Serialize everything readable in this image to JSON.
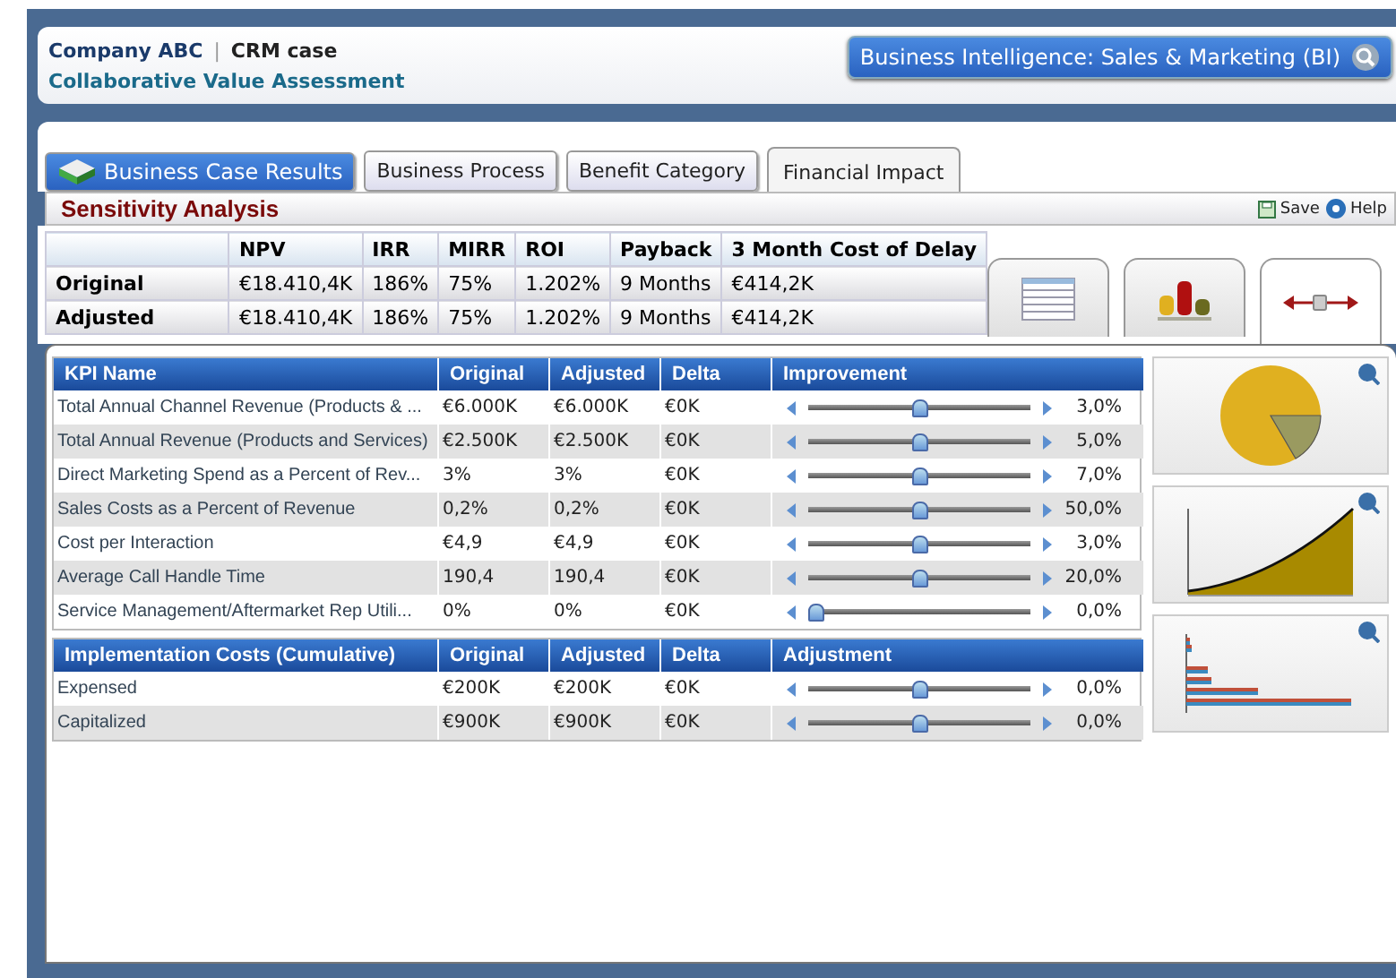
{
  "header": {
    "company": "Company ABC",
    "separator": "|",
    "case": "CRM case",
    "subtitle": "Collaborative Value Assessment",
    "bi_button": "Business Intelligence: Sales & Marketing (BI)"
  },
  "tabs": [
    {
      "label": "Business Case Results",
      "kind": "primary",
      "selected": false
    },
    {
      "label": "Business Process",
      "kind": "tab",
      "selected": false
    },
    {
      "label": "Benefit Category",
      "kind": "tab",
      "selected": false
    },
    {
      "label": "Financial Impact",
      "kind": "tab",
      "selected": true
    }
  ],
  "section": {
    "title": "Sensitivity Analysis",
    "actions": [
      "Save",
      "Help"
    ]
  },
  "summary": {
    "columns": [
      "NPV",
      "IRR",
      "MIRR",
      "ROI",
      "Payback",
      "3 Month Cost of Delay"
    ],
    "rows": [
      {
        "label": "Original",
        "cells": [
          "€18.410,4K",
          "186%",
          "75%",
          "1.202%",
          "9 Months",
          "€414,2K"
        ]
      },
      {
        "label": "Adjusted",
        "cells": [
          "€18.410,4K",
          "186%",
          "75%",
          "1.202%",
          "9 Months",
          "€414,2K"
        ]
      }
    ]
  },
  "view_tabs": [
    {
      "kind": "table",
      "selected": false
    },
    {
      "kind": "bars",
      "selected": false
    },
    {
      "kind": "slider",
      "selected": true
    }
  ],
  "kpi_table": {
    "columns": [
      "KPI Name",
      "Original",
      "Adjusted",
      "Delta",
      "Improvement"
    ],
    "rows": [
      {
        "name": "Total Annual Channel Revenue (Products & ...",
        "original": "€6.000K",
        "adjusted": "€6.000K",
        "delta": "€0K",
        "level": 0.5,
        "reading": "3,0%"
      },
      {
        "name": "Total Annual Revenue (Products and Services)",
        "original": "€2.500K",
        "adjusted": "€2.500K",
        "delta": "€0K",
        "level": 0.5,
        "reading": "5,0%"
      },
      {
        "name": "Direct Marketing Spend as a Percent of Rev...",
        "original": "3%",
        "adjusted": "3%",
        "delta": "€0K",
        "level": 0.5,
        "reading": "7,0%"
      },
      {
        "name": "Sales Costs as a Percent of Revenue",
        "original": "0,2%",
        "adjusted": "0,2%",
        "delta": "€0K",
        "level": 0.5,
        "reading": "50,0%"
      },
      {
        "name": "Cost per Interaction",
        "original": "€4,9",
        "adjusted": "€4,9",
        "delta": "€0K",
        "level": 0.5,
        "reading": "3,0%"
      },
      {
        "name": "Average Call Handle Time",
        "original": "190,4",
        "adjusted": "190,4",
        "delta": "€0K",
        "level": 0.5,
        "reading": "20,0%"
      },
      {
        "name": "Service Management/Aftermarket Rep Utili...",
        "original": "0%",
        "adjusted": "0%",
        "delta": "€0K",
        "level": 0,
        "reading": "0,0%"
      }
    ]
  },
  "cost_table": {
    "columns": [
      "Implementation Costs (Cumulative)",
      "Original",
      "Adjusted",
      "Delta",
      "Adjustment"
    ],
    "rows": [
      {
        "name": "Expensed",
        "original": "€200K",
        "adjusted": "€200K",
        "delta": "€0K",
        "level": 0.5,
        "reading": "0,0%"
      },
      {
        "name": "Capitalized",
        "original": "€900K",
        "adjusted": "€900K",
        "delta": "€0K",
        "level": 0.5,
        "reading": "0,0%"
      }
    ]
  },
  "thumbnails": [
    {
      "kind": "pie"
    },
    {
      "kind": "area"
    },
    {
      "kind": "bars"
    }
  ]
}
